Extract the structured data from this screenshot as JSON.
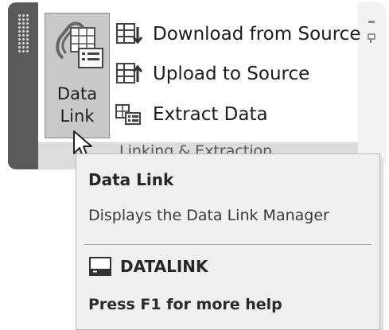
{
  "ribbon": {
    "big_button": {
      "line1": "Data",
      "line2": "Link"
    },
    "commands": [
      {
        "label": "Download from Source",
        "icon": "download-from-source-icon"
      },
      {
        "label": "Upload to Source",
        "icon": "upload-to-source-icon"
      },
      {
        "label": "Extract  Data",
        "icon": "extract-data-icon"
      }
    ],
    "panel_title": "Linking & Extraction"
  },
  "tooltip": {
    "title": "Data Link",
    "description": "Displays the Data Link Manager",
    "command": "DATALINK",
    "help": "Press F1 for more help"
  }
}
